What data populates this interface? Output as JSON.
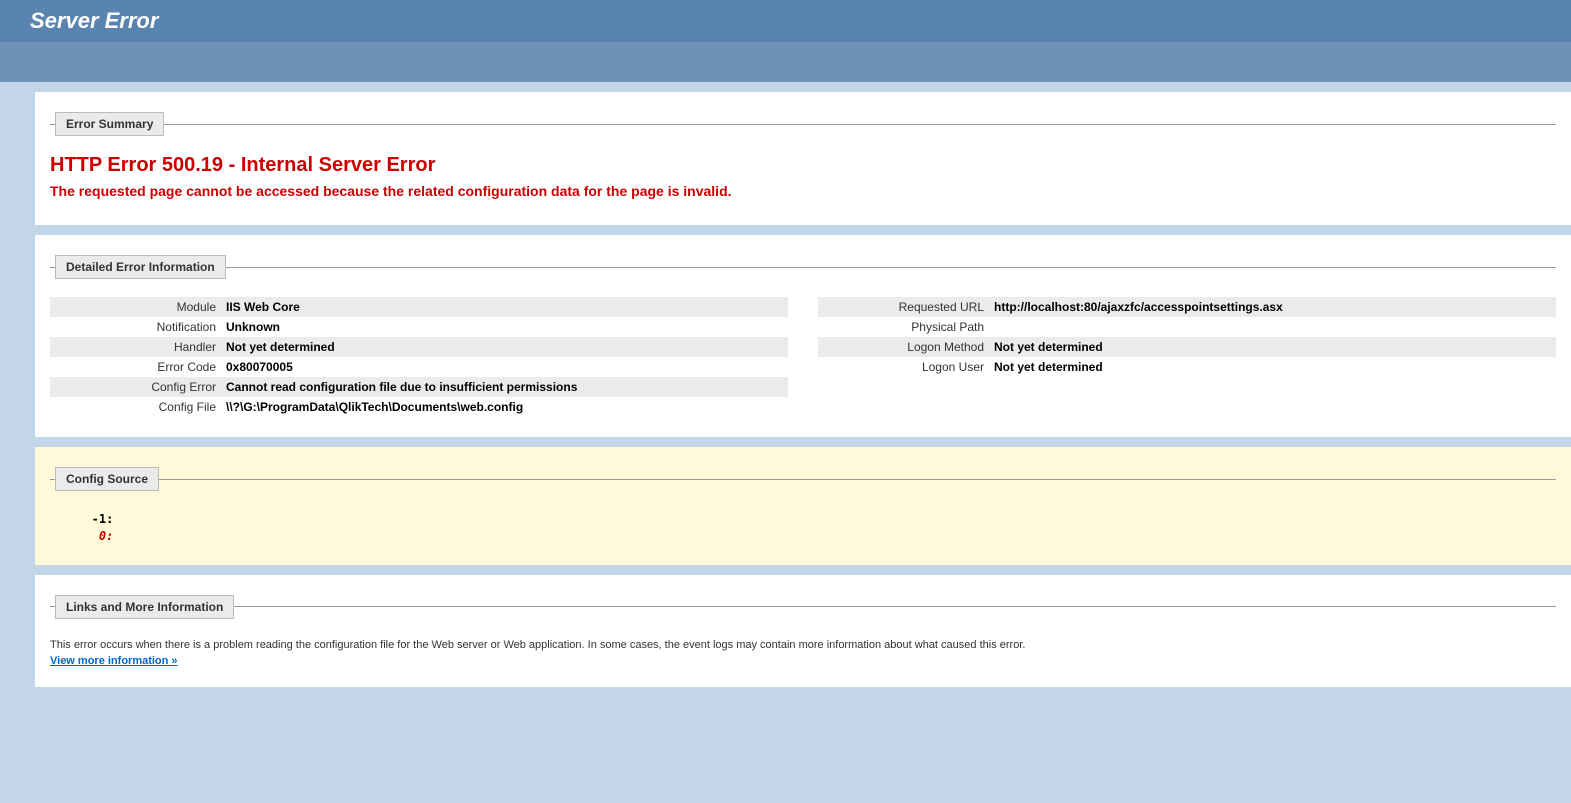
{
  "header": {
    "title": "Server Error"
  },
  "errorSummary": {
    "legend": "Error Summary",
    "title": "HTTP Error 500.19 - Internal Server Error",
    "subtitle": "The requested page cannot be accessed because the related configuration data for the page is invalid."
  },
  "detailed": {
    "legend": "Detailed Error Information",
    "left": [
      {
        "label": "Module",
        "value": "IIS Web Core"
      },
      {
        "label": "Notification",
        "value": "Unknown"
      },
      {
        "label": "Handler",
        "value": "Not yet determined"
      },
      {
        "label": "Error Code",
        "value": "0x80070005"
      },
      {
        "label": "Config Error",
        "value": "Cannot read configuration file due to insufficient permissions"
      },
      {
        "label": "Config File",
        "value": "\\\\?\\G:\\ProgramData\\QlikTech\\Documents\\web.config"
      }
    ],
    "right": [
      {
        "label": "Requested URL",
        "value": "http://localhost:80/ajaxzfc/accesspointsettings.asx"
      },
      {
        "label": "Physical Path",
        "value": ""
      },
      {
        "label": "Logon Method",
        "value": "Not yet determined"
      },
      {
        "label": "Logon User",
        "value": "Not yet determined"
      }
    ]
  },
  "configSource": {
    "legend": "Config Source",
    "line0": "   -1: ",
    "line1": "    0: "
  },
  "links": {
    "legend": "Links and More Information",
    "text": "This error occurs when there is a problem reading the configuration file for the Web server or Web application. In some cases, the event logs may contain more information about what caused this error.",
    "moreLink": "View more information »"
  }
}
